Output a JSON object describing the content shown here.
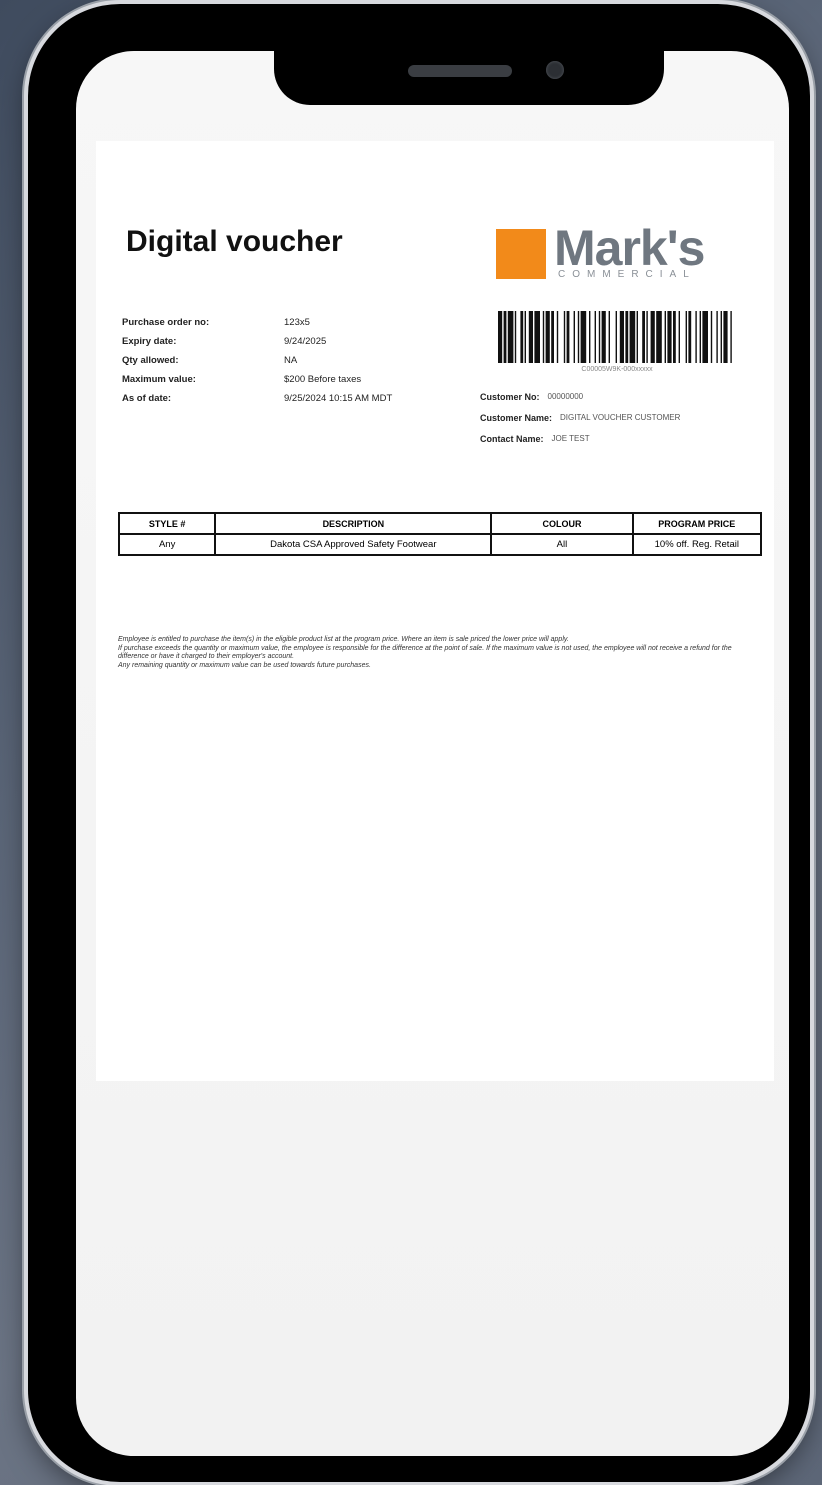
{
  "document": {
    "title": "Digital voucher",
    "brand": {
      "name": "Mark's",
      "subline": "COMMERCIAL",
      "colors": {
        "box": "#f28a1a",
        "text": "#6f7780"
      }
    },
    "details": [
      {
        "label": "Purchase order no:",
        "value": "123x5"
      },
      {
        "label": "Expiry date:",
        "value": "9/24/2025"
      },
      {
        "label": "Qty allowed:",
        "value": "NA"
      },
      {
        "label": "Maximum value:",
        "value": "$200 Before taxes"
      },
      {
        "label": "As of date:",
        "value": "9/25/2024 10:15 AM MDT"
      }
    ],
    "barcode_number": "C00005W9K-000xxxxx",
    "customer": [
      {
        "label": "Customer No:",
        "value": "00000000"
      },
      {
        "label": "Customer Name:",
        "value": "DIGITAL VOUCHER CUSTOMER"
      },
      {
        "label": "Contact Name:",
        "value": "JOE TEST"
      }
    ],
    "table": {
      "headers": [
        "STYLE #",
        "DESCRIPTION",
        "COLOUR",
        "PROGRAM PRICE"
      ],
      "rows": [
        [
          "Any",
          "Dakota CSA Approved Safety Footwear",
          "All",
          "10% off. Reg. Retail"
        ]
      ]
    },
    "fine_print": [
      "Employee is entitled to purchase the item(s) in the eligible product list at the program price. Where an item is sale priced the lower price will apply.",
      "If purchase exceeds the quantity or maximum value, the employee is responsible for the difference at the point of sale. If the maximum value is not used, the employee will not receive a refund for the difference or have it charged to their employer's account.",
      "Any remaining quantity or maximum value can be used towards future purchases."
    ]
  }
}
